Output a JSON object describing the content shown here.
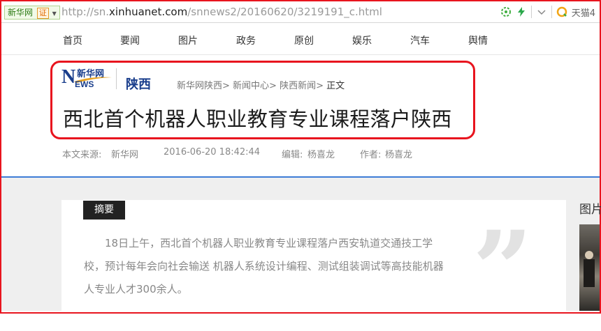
{
  "browser": {
    "site_tag": "新华网",
    "cert_label": "证",
    "url_prefix": "http://sn.",
    "url_host": "xinhuanet.com",
    "url_path": "/snnews2/20160620/3219191_c.html",
    "tmall_label": "天猫4"
  },
  "nav": {
    "items": [
      "首页",
      "要闻",
      "图片",
      "政务",
      "原创",
      "娱乐",
      "汽车",
      "舆情"
    ]
  },
  "header": {
    "logo_cn": "新华网",
    "logo_n": "N",
    "logo_ews": "EWS",
    "region": "陕西",
    "breadcrumb": [
      "新华网陕西>",
      "新闻中心>",
      "陕西新闻>"
    ],
    "breadcrumb_current": "正文"
  },
  "article": {
    "title": "西北首个机器人职业教育专业课程落户陕西",
    "source_label": "本文来源:",
    "source": "新华网",
    "datetime": "2016-06-20 18:42:44",
    "editor_label": "编辑:",
    "editor": "杨喜龙",
    "author_label": "作者:",
    "author": "杨喜龙",
    "summary_badge": "摘要",
    "summary": "18日上午，西北首个机器人职业教育专业课程落户西安轨道交通技工学校，预计每年会向社会输送 机器人系统设计编程、测试组装调试等高技能机器人专业人才300余人。",
    "quote_mark": "”"
  },
  "sidebar": {
    "title": "图片"
  },
  "colors": {
    "highlight": "#e8141e",
    "brand_blue": "#1a3e8c",
    "divider_blue": "#3d7bd6"
  }
}
